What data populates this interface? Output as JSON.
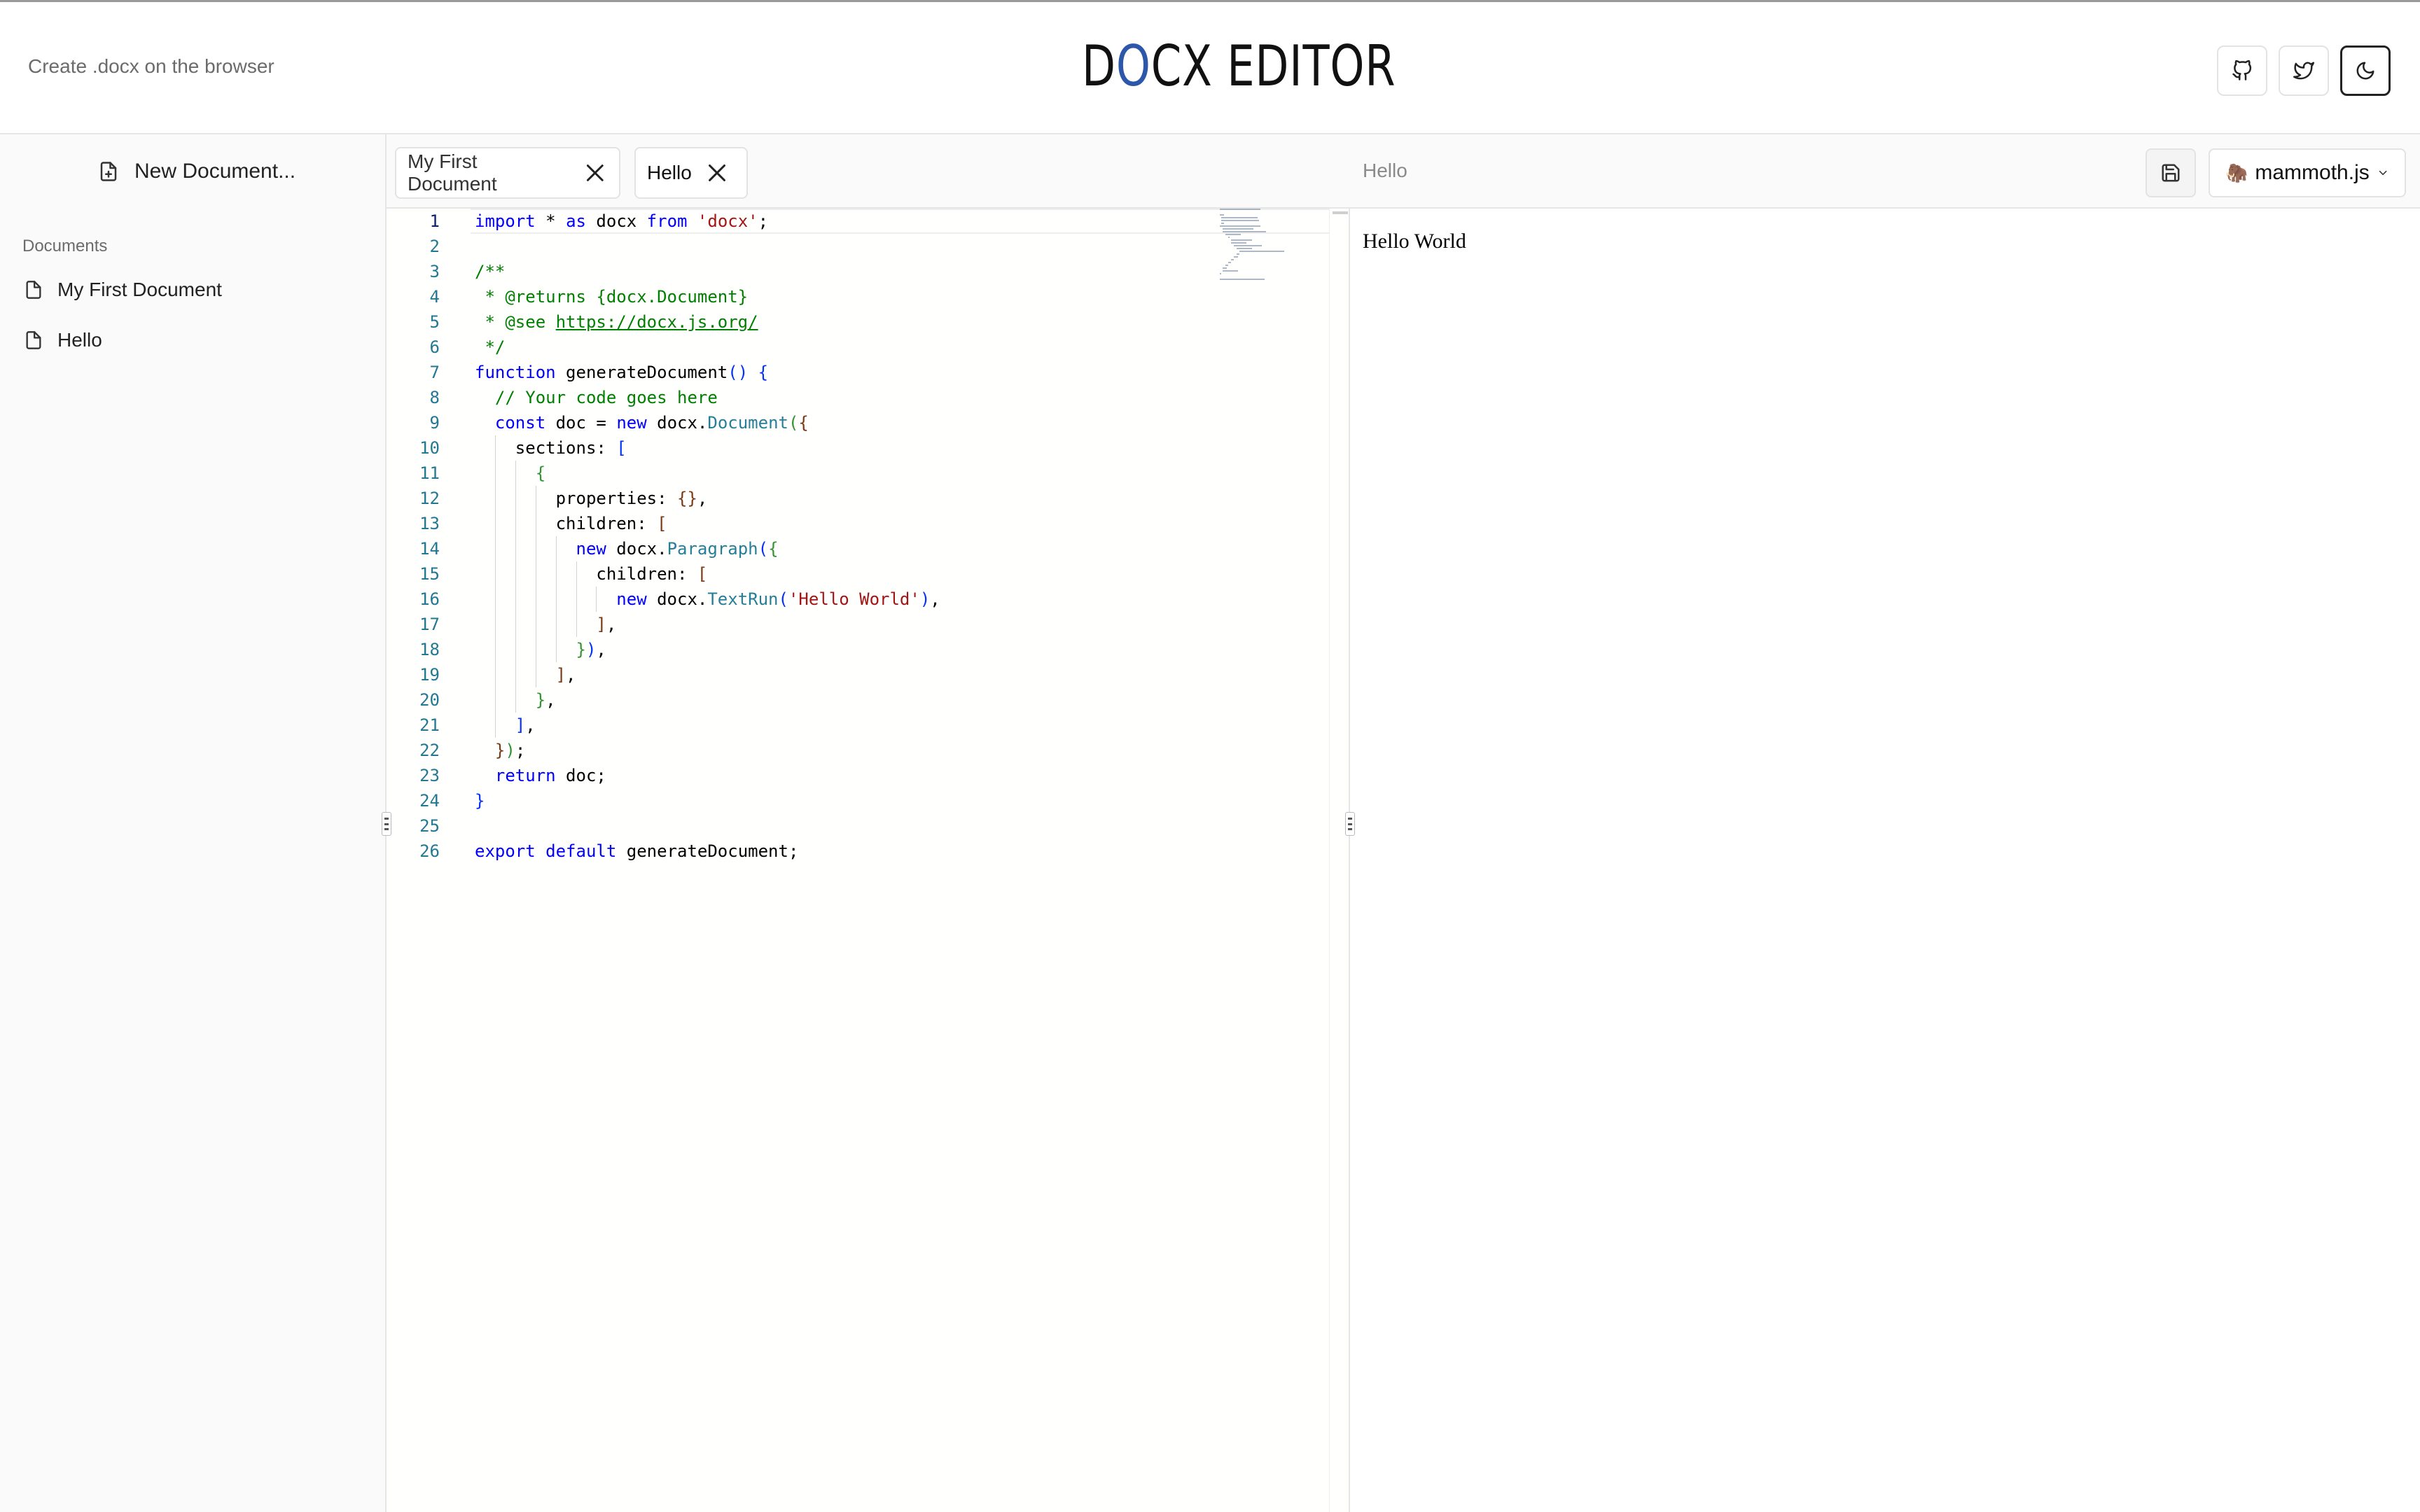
{
  "header": {
    "tagline": "Create .docx on the browser",
    "logo": {
      "before": "D",
      "o": "O",
      "after": "CX EDITOR"
    },
    "buttons": [
      {
        "name": "github-button",
        "icon": "github-icon"
      },
      {
        "name": "twitter-button",
        "icon": "twitter-icon"
      },
      {
        "name": "dark-mode-button",
        "icon": "moon-icon"
      }
    ]
  },
  "sidebar": {
    "new_document_label": "New Document...",
    "documents_heading": "Documents",
    "documents": [
      {
        "label": "My First Document",
        "icon": "file-icon"
      },
      {
        "label": "Hello",
        "icon": "file-icon"
      }
    ]
  },
  "editor": {
    "tabs": [
      {
        "label": "My First Document",
        "active": false
      },
      {
        "label": "Hello",
        "active": true
      }
    ],
    "current_line": 1,
    "lines": [
      "import * as docx from 'docx';",
      "",
      "/**",
      " * @returns {docx.Document}",
      " * @see https://docx.js.org/",
      " */",
      "function generateDocument() {",
      "  // Your code goes here",
      "  const doc = new docx.Document({",
      "    sections: [",
      "      {",
      "        properties: {},",
      "        children: [",
      "          new docx.Paragraph({",
      "            children: [",
      "              new docx.TextRun('Hello World'),",
      "            ],",
      "          }),",
      "        ],",
      "      },",
      "    ],",
      "  });",
      "  return doc;",
      "}",
      "",
      "export default generateDocument;"
    ]
  },
  "preview": {
    "title": "Hello",
    "library": "mammoth.js",
    "library_emoji": "🦣",
    "content": "Hello World"
  },
  "colors": {
    "accent": "#2d57a8",
    "keyword": "#0000ff",
    "string": "#a31515",
    "comment": "#008000",
    "type": "#267f99",
    "line_number": "#237893"
  }
}
